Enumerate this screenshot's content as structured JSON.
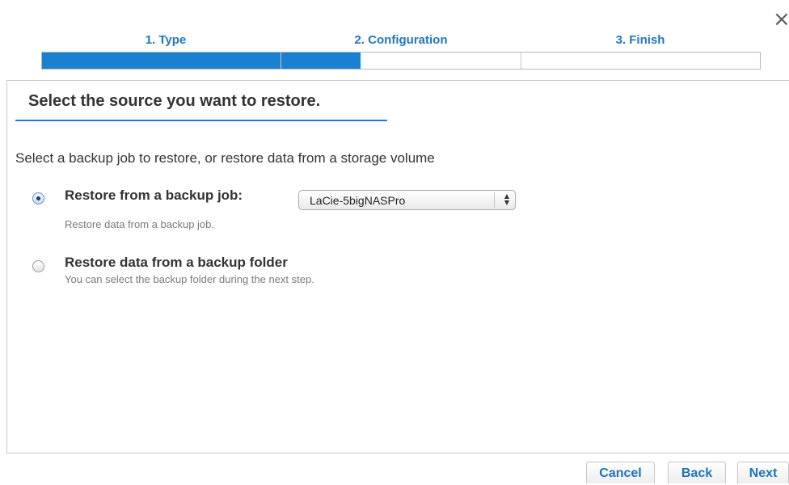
{
  "dialog": {
    "close_glyph": "×",
    "close_icon": "close-icon"
  },
  "steps": [
    {
      "label": "1. Type",
      "progress": 1.0
    },
    {
      "label": "2. Configuration",
      "progress": 0.33
    },
    {
      "label": "3. Finish",
      "progress": 0.0
    }
  ],
  "panel": {
    "title": "Select the source you want to restore.",
    "intro": "Select a backup job to restore, or restore data from a storage volume"
  },
  "options": [
    {
      "label": "Restore from a backup job:",
      "description": "Restore data from a backup job.",
      "selected": true,
      "select": {
        "value": "LaCie-5bigNASPro",
        "arrows_icon": "up-down-arrows-icon"
      }
    },
    {
      "label": "Restore data from a backup folder",
      "description": "You can select the backup folder during the next step.",
      "selected": false
    }
  ],
  "buttons": {
    "cancel": "Cancel",
    "back": "Back",
    "next": "Next"
  },
  "colors": {
    "accent": "#1a80d0",
    "step_label": "#2276c0",
    "button_text": "#1e72be",
    "title_underline": "#1e7fd0"
  }
}
